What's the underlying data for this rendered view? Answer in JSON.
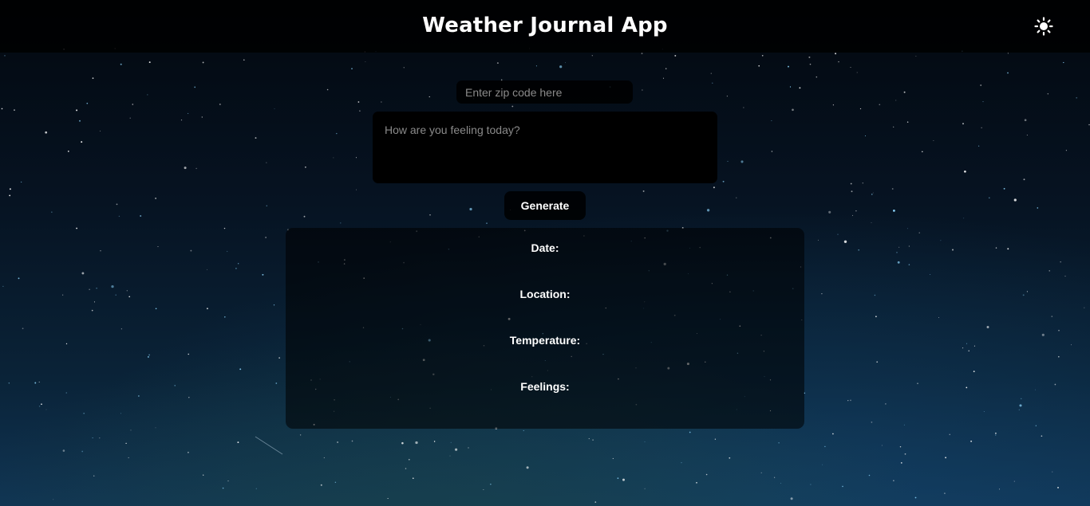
{
  "header": {
    "title": "Weather Journal App",
    "theme_toggle_icon": "sun-icon"
  },
  "form": {
    "zip_placeholder": "Enter zip code here",
    "zip_value": "",
    "feelings_placeholder": "How are you feeling today?",
    "feelings_value": "",
    "generate_label": "Generate"
  },
  "entry": {
    "date_label": "Date:",
    "location_label": "Location:",
    "temperature_label": "Temperature:",
    "feelings_label": "Feelings:"
  },
  "colors": {
    "text": "#ffffff",
    "header_bg": "#000000",
    "panel_bg": "#000000"
  }
}
